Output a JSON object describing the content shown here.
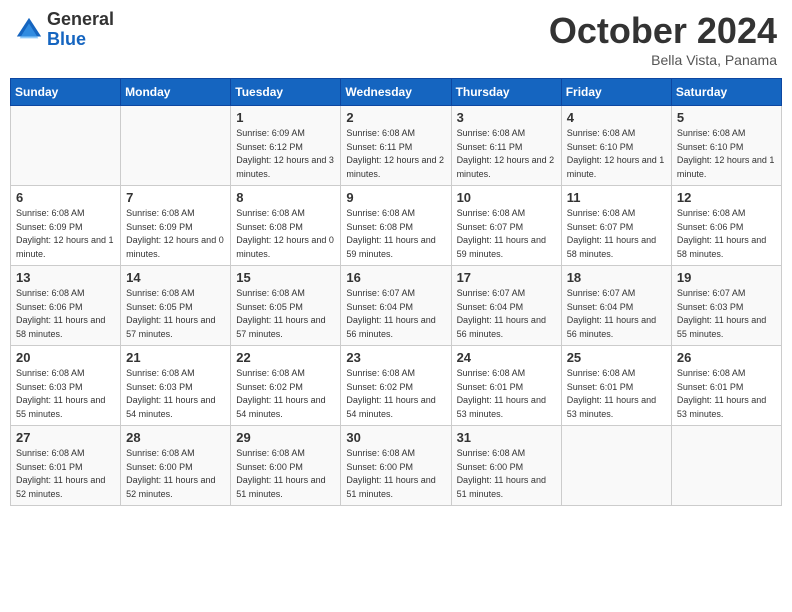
{
  "header": {
    "logo_general": "General",
    "logo_blue": "Blue",
    "month_title": "October 2024",
    "location": "Bella Vista, Panama"
  },
  "days_of_week": [
    "Sunday",
    "Monday",
    "Tuesday",
    "Wednesday",
    "Thursday",
    "Friday",
    "Saturday"
  ],
  "weeks": [
    [
      {
        "day": "",
        "info": ""
      },
      {
        "day": "",
        "info": ""
      },
      {
        "day": "1",
        "info": "Sunrise: 6:09 AM\nSunset: 6:12 PM\nDaylight: 12 hours and 3 minutes."
      },
      {
        "day": "2",
        "info": "Sunrise: 6:08 AM\nSunset: 6:11 PM\nDaylight: 12 hours and 2 minutes."
      },
      {
        "day": "3",
        "info": "Sunrise: 6:08 AM\nSunset: 6:11 PM\nDaylight: 12 hours and 2 minutes."
      },
      {
        "day": "4",
        "info": "Sunrise: 6:08 AM\nSunset: 6:10 PM\nDaylight: 12 hours and 1 minute."
      },
      {
        "day": "5",
        "info": "Sunrise: 6:08 AM\nSunset: 6:10 PM\nDaylight: 12 hours and 1 minute."
      }
    ],
    [
      {
        "day": "6",
        "info": "Sunrise: 6:08 AM\nSunset: 6:09 PM\nDaylight: 12 hours and 1 minute."
      },
      {
        "day": "7",
        "info": "Sunrise: 6:08 AM\nSunset: 6:09 PM\nDaylight: 12 hours and 0 minutes."
      },
      {
        "day": "8",
        "info": "Sunrise: 6:08 AM\nSunset: 6:08 PM\nDaylight: 12 hours and 0 minutes."
      },
      {
        "day": "9",
        "info": "Sunrise: 6:08 AM\nSunset: 6:08 PM\nDaylight: 11 hours and 59 minutes."
      },
      {
        "day": "10",
        "info": "Sunrise: 6:08 AM\nSunset: 6:07 PM\nDaylight: 11 hours and 59 minutes."
      },
      {
        "day": "11",
        "info": "Sunrise: 6:08 AM\nSunset: 6:07 PM\nDaylight: 11 hours and 58 minutes."
      },
      {
        "day": "12",
        "info": "Sunrise: 6:08 AM\nSunset: 6:06 PM\nDaylight: 11 hours and 58 minutes."
      }
    ],
    [
      {
        "day": "13",
        "info": "Sunrise: 6:08 AM\nSunset: 6:06 PM\nDaylight: 11 hours and 58 minutes."
      },
      {
        "day": "14",
        "info": "Sunrise: 6:08 AM\nSunset: 6:05 PM\nDaylight: 11 hours and 57 minutes."
      },
      {
        "day": "15",
        "info": "Sunrise: 6:08 AM\nSunset: 6:05 PM\nDaylight: 11 hours and 57 minutes."
      },
      {
        "day": "16",
        "info": "Sunrise: 6:07 AM\nSunset: 6:04 PM\nDaylight: 11 hours and 56 minutes."
      },
      {
        "day": "17",
        "info": "Sunrise: 6:07 AM\nSunset: 6:04 PM\nDaylight: 11 hours and 56 minutes."
      },
      {
        "day": "18",
        "info": "Sunrise: 6:07 AM\nSunset: 6:04 PM\nDaylight: 11 hours and 56 minutes."
      },
      {
        "day": "19",
        "info": "Sunrise: 6:07 AM\nSunset: 6:03 PM\nDaylight: 11 hours and 55 minutes."
      }
    ],
    [
      {
        "day": "20",
        "info": "Sunrise: 6:08 AM\nSunset: 6:03 PM\nDaylight: 11 hours and 55 minutes."
      },
      {
        "day": "21",
        "info": "Sunrise: 6:08 AM\nSunset: 6:03 PM\nDaylight: 11 hours and 54 minutes."
      },
      {
        "day": "22",
        "info": "Sunrise: 6:08 AM\nSunset: 6:02 PM\nDaylight: 11 hours and 54 minutes."
      },
      {
        "day": "23",
        "info": "Sunrise: 6:08 AM\nSunset: 6:02 PM\nDaylight: 11 hours and 54 minutes."
      },
      {
        "day": "24",
        "info": "Sunrise: 6:08 AM\nSunset: 6:01 PM\nDaylight: 11 hours and 53 minutes."
      },
      {
        "day": "25",
        "info": "Sunrise: 6:08 AM\nSunset: 6:01 PM\nDaylight: 11 hours and 53 minutes."
      },
      {
        "day": "26",
        "info": "Sunrise: 6:08 AM\nSunset: 6:01 PM\nDaylight: 11 hours and 53 minutes."
      }
    ],
    [
      {
        "day": "27",
        "info": "Sunrise: 6:08 AM\nSunset: 6:01 PM\nDaylight: 11 hours and 52 minutes."
      },
      {
        "day": "28",
        "info": "Sunrise: 6:08 AM\nSunset: 6:00 PM\nDaylight: 11 hours and 52 minutes."
      },
      {
        "day": "29",
        "info": "Sunrise: 6:08 AM\nSunset: 6:00 PM\nDaylight: 11 hours and 51 minutes."
      },
      {
        "day": "30",
        "info": "Sunrise: 6:08 AM\nSunset: 6:00 PM\nDaylight: 11 hours and 51 minutes."
      },
      {
        "day": "31",
        "info": "Sunrise: 6:08 AM\nSunset: 6:00 PM\nDaylight: 11 hours and 51 minutes."
      },
      {
        "day": "",
        "info": ""
      },
      {
        "day": "",
        "info": ""
      }
    ]
  ]
}
